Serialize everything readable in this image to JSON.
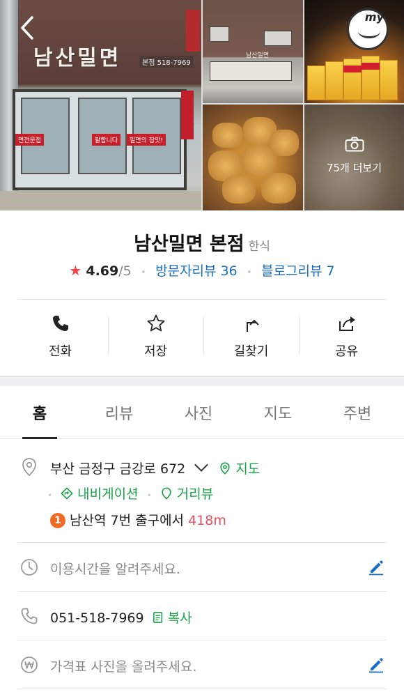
{
  "header": {
    "back_icon": "chevron-left-icon",
    "photo_more_label": "75개 더보기",
    "camera_icon": "camera-icon",
    "store_sign": "남산밀면",
    "store_phone_sign": "본점 518-7969",
    "store_banner_1": "면전문점",
    "store_banner_2": "팔합니다",
    "store_banner_3": "밀면의 참맛!",
    "street_sign": "남산밀면",
    "my_badge": "my"
  },
  "place": {
    "name": "남산밀면 본점",
    "category": "한식",
    "rating": "4.69",
    "rating_max": "/5",
    "visitor_review": "방문자리뷰 36",
    "blog_review": "블로그리뷰 7"
  },
  "actions": [
    {
      "label": "전화",
      "icon": "phone-icon"
    },
    {
      "label": "저장",
      "icon": "star-outline-icon"
    },
    {
      "label": "길찾기",
      "icon": "directions-icon"
    },
    {
      "label": "공유",
      "icon": "share-icon"
    }
  ],
  "tabs": [
    "홈",
    "리뷰",
    "사진",
    "지도",
    "주변"
  ],
  "info": {
    "address": "부산 금정구 금강로 672",
    "map_link": "지도",
    "navigation_link": "내비게이션",
    "streetview_link": "거리뷰",
    "transit_number": "1",
    "transit_station": "남산역",
    "transit_exit": "7번 출구에서",
    "transit_distance": "418m",
    "hours_placeholder": "이용시간을 알려주세요.",
    "phone": "051-518-7969",
    "copy_label": "복사",
    "price_placeholder": "가격표 사진을 올려주세요."
  },
  "colors": {
    "accent_green": "#1aa34a",
    "link_blue": "#1a6dc4",
    "star_red": "#f04646",
    "distance_red": "#e04f5f",
    "edit_blue": "#1a6dc4"
  }
}
